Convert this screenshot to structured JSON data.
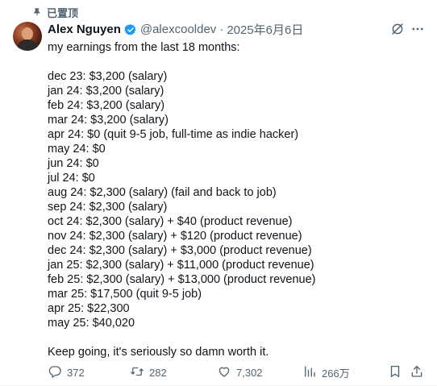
{
  "pinned": {
    "label": "已置顶"
  },
  "author": {
    "name": "Alex Nguyen",
    "handle": "@alexcooldev",
    "separator": "·",
    "date": "2025年6月6日"
  },
  "tweet_lines": [
    "my earnings from the last 18 months:",
    "",
    "dec 23: $3,200 (salary)",
    "jan 24: $3,200 (salary)",
    "feb 24: $3,200 (salary)",
    "mar 24: $3,200 (salary)",
    "apr 24: $0 (quit 9-5 job, full-time as indie hacker)",
    "may 24: $0",
    "jun 24: $0",
    "jul 24: $0",
    "aug 24: $2,300 (salary) (fail and back to job)",
    "sep 24: $2,300 (salary)",
    "oct 24: $2,300 (salary) + $40 (product revenue)",
    "nov 24: $2,300 (salary) + $120 (product revenue)",
    "dec 24: $2,300 (salary) + $3,000 (product revenue)",
    "jan 25: $2,300 (salary) + $11,000 (product revenue)",
    "feb 25: $2,300 (salary) + $13,000 (product revenue)",
    "mar 25: $17,500 (quit 9-5 job)",
    "apr 25: $22,300",
    "may 25: $40,020",
    "",
    "Keep going, it's seriously so damn worth it."
  ],
  "actions": {
    "replies": "372",
    "retweets": "282",
    "likes": "7,302",
    "views": "266万"
  },
  "icons": {
    "pin": "pin-icon",
    "verified": "verified-badge-icon",
    "grok": "grok-icon",
    "more": "more-icon",
    "reply": "reply-icon",
    "retweet": "retweet-icon",
    "like": "heart-icon",
    "views": "views-icon",
    "bookmark": "bookmark-icon",
    "share": "share-icon"
  },
  "colors": {
    "text": "#0f1419",
    "secondary": "#536471",
    "verified": "#1d9bf0"
  }
}
